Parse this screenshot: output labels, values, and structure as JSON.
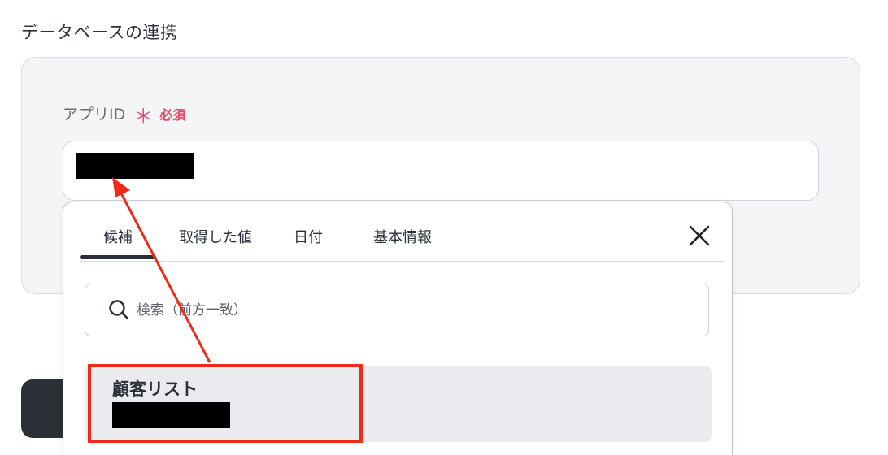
{
  "section": {
    "title": "データベースの連携"
  },
  "field": {
    "label": "アプリID",
    "asterisk": "＊",
    "required": "必須"
  },
  "popover": {
    "tabs": [
      {
        "label": "候補",
        "active": true
      },
      {
        "label": "取得した値"
      },
      {
        "label": "日付"
      },
      {
        "label": "基本情報"
      }
    ],
    "search": {
      "placeholder": "検索（前方一致）",
      "value": ""
    },
    "candidates": [
      {
        "title": "顧客リスト"
      }
    ]
  },
  "colors": {
    "required": "#e2476b",
    "annotation": "#ee2a1b",
    "active_tab": "#2c3036",
    "candidate_bg": "#e9ebef"
  },
  "icons": {
    "close": "close-icon",
    "search": "search-icon"
  }
}
